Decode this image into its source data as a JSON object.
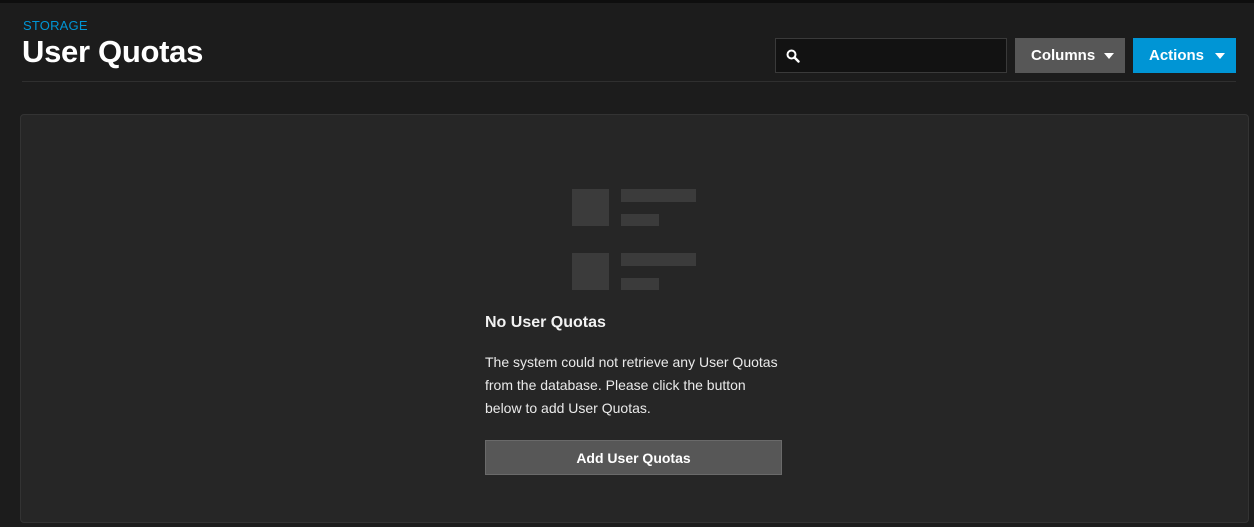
{
  "header": {
    "breadcrumb": "STORAGE",
    "title": "User Quotas"
  },
  "toolbar": {
    "search_placeholder": "",
    "search_value": "",
    "columns_label": "Columns",
    "actions_label": "Actions"
  },
  "empty_state": {
    "icon": "table-placeholder-icon",
    "title": "No User Quotas",
    "message": "The system could not retrieve any User Quotas from the database. Please click the button below to add User Quotas.",
    "button_label": "Add User Quotas"
  },
  "colors": {
    "accent": "#0095d5",
    "background": "#1c1c1c",
    "card": "#262626",
    "button_secondary": "#575757"
  }
}
